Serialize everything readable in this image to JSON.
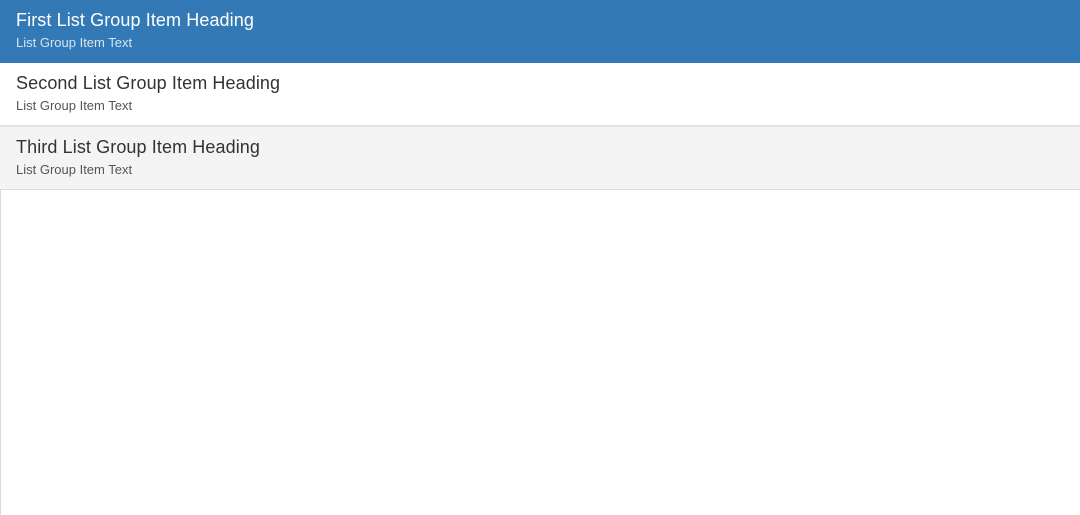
{
  "theme": {
    "active_background": "#3279b6",
    "active_heading_color": "#ffffff",
    "active_text_color": "#d7e5f1",
    "default_background": "#ffffff",
    "hover_background": "#f4f4f5",
    "heading_color": "#333333",
    "text_color": "#555555",
    "divider_color": "#dddddd",
    "container_border_color": "#d9d9de"
  },
  "list_group": {
    "items": [
      {
        "heading": "First List Group Item Heading",
        "text": "List Group Item Text",
        "state": "active"
      },
      {
        "heading": "Second List Group Item Heading",
        "text": "List Group Item Text",
        "state": "default"
      },
      {
        "heading": "Third List Group Item Heading",
        "text": "List Group Item Text",
        "state": "hover"
      }
    ]
  }
}
